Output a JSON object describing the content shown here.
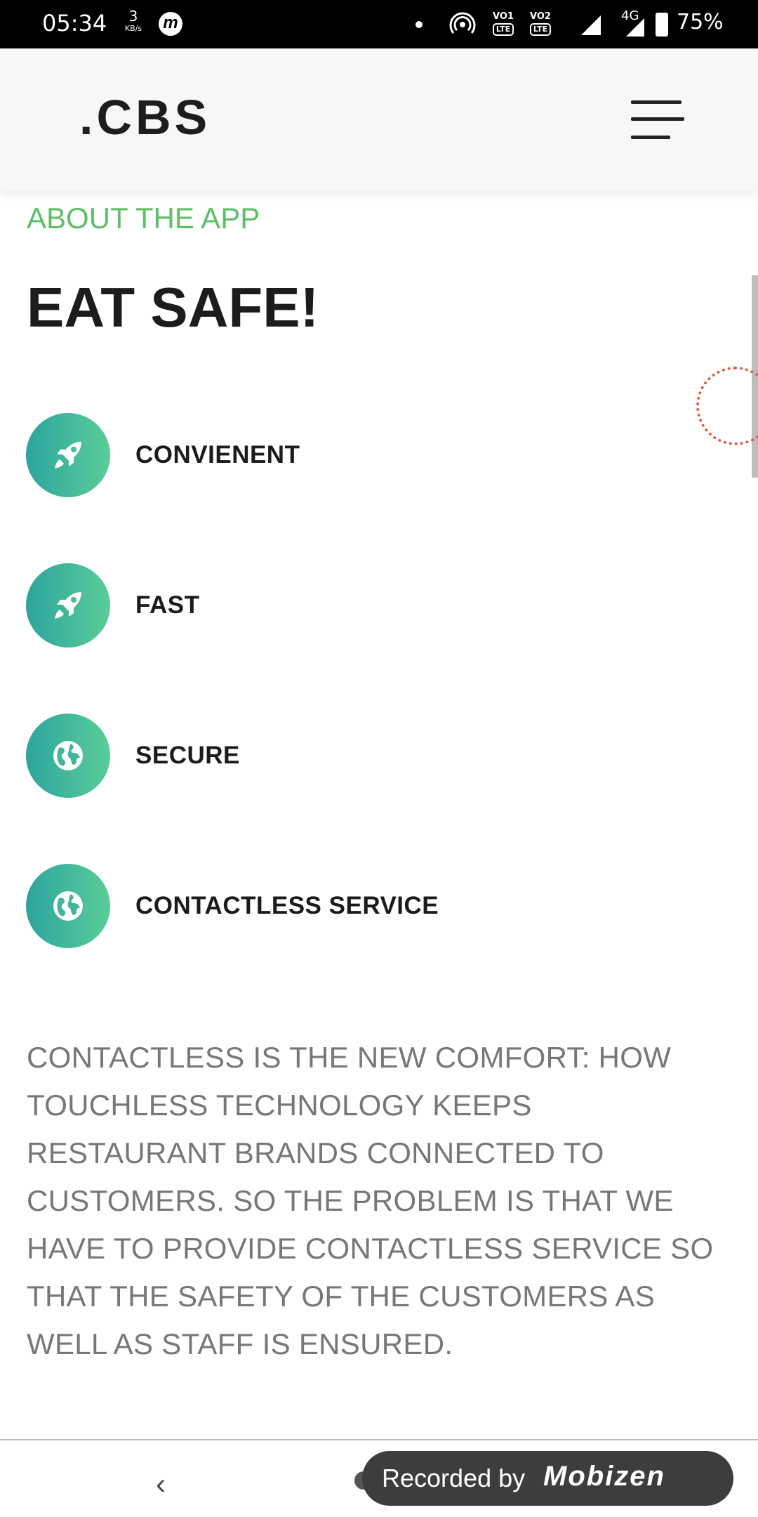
{
  "status_bar": {
    "time": "05:34",
    "speed_value": "3",
    "speed_unit": "KB/s",
    "app_icon": "m",
    "volte1": "VO1",
    "volte2": "VO2",
    "lte": "LTE",
    "network": "4G",
    "battery": "75%"
  },
  "header": {
    "brand": ".CBS",
    "menu_icon": "hamburger-menu-icon"
  },
  "about": {
    "label": "ABOUT THE APP",
    "title": "EAT SAFE!"
  },
  "features": [
    {
      "label": "CONVIENENT",
      "icon": "rocket-icon"
    },
    {
      "label": "FAST",
      "icon": "rocket-icon"
    },
    {
      "label": "SECURE",
      "icon": "globe-icon"
    },
    {
      "label": "CONTACTLESS SERVICE",
      "icon": "globe-icon"
    }
  ],
  "description": "CONTACTLESS IS THE NEW COMFORT: HOW TOUCHLESS TECHNOLOGY KEEPS RESTAURANT BRANDS CONNECTED TO CUSTOMERS. SO THE PROBLEM IS THAT WE HAVE TO PROVIDE CONTACTLESS SERVICE SO THAT THE SAFETY OF THE CUSTOMERS AS WELL AS STAFF IS ENSURED.",
  "watermark": {
    "text": "Recorded by",
    "brand": "Mobizen"
  },
  "colors": {
    "accent_green": "#5fbf68",
    "icon_gradient_start": "#2ba59d",
    "icon_gradient_end": "#5bcd98"
  }
}
